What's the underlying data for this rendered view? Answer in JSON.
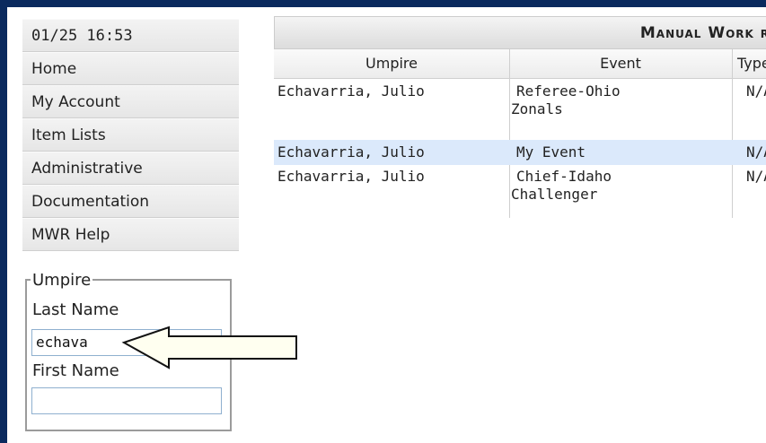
{
  "sidebar": {
    "datetime": "01/25 16:53",
    "items": [
      {
        "label": "Home"
      },
      {
        "label": "My Account"
      },
      {
        "label": "Item Lists"
      },
      {
        "label": "Administrative"
      },
      {
        "label": "Documentation"
      },
      {
        "label": "MWR Help"
      }
    ]
  },
  "umpire_filter": {
    "legend": "Umpire",
    "last_name_label": "Last Name",
    "last_name_value": "echava",
    "first_name_label": "First Name",
    "first_name_value": ""
  },
  "table": {
    "title": "Manual Work rec",
    "columns": [
      "Umpire",
      "Event",
      "Type"
    ],
    "rows": [
      {
        "umpire": "Echavarria, Julio",
        "event_line1": "Referee-Ohio",
        "event_line2": "Zonals",
        "type": "N/A"
      },
      {
        "umpire": "Echavarria, Julio",
        "event_line1": "My Event",
        "event_line2": "",
        "type": "N/A"
      },
      {
        "umpire": "Echavarria, Julio",
        "event_line1": "Chief-Idaho",
        "event_line2": "Challenger",
        "type": "N/A"
      }
    ]
  },
  "colors": {
    "frame_border": "#0b2a5e",
    "selected_row": "#dbe9fb",
    "arrow_fill": "#fffff0"
  }
}
